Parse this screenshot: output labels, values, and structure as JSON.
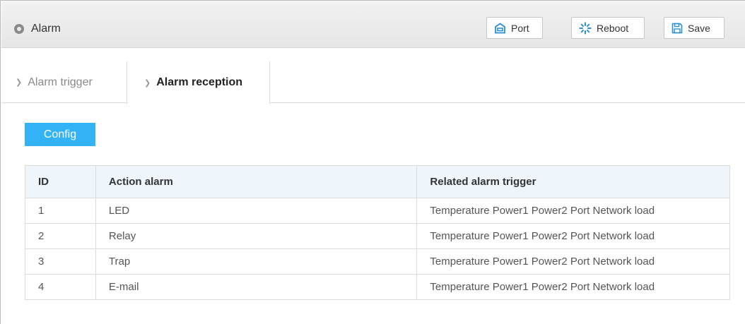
{
  "header": {
    "title": "Alarm",
    "buttons": {
      "port": "Port",
      "reboot": "Reboot",
      "save": "Save"
    }
  },
  "tabs": [
    {
      "label": "Alarm trigger",
      "active": false
    },
    {
      "label": "Alarm reception",
      "active": true
    }
  ],
  "config_label": "Config",
  "table": {
    "columns": [
      "ID",
      "Action alarm",
      "Related alarm trigger"
    ],
    "rows": [
      {
        "id": "1",
        "action": "LED",
        "related": "Temperature Power1 Power2 Port Network load"
      },
      {
        "id": "2",
        "action": "Relay",
        "related": "Temperature Power1 Power2 Port Network load"
      },
      {
        "id": "3",
        "action": "Trap",
        "related": "Temperature Power1 Power2 Port Network load"
      },
      {
        "id": "4",
        "action": "E-mail",
        "related": "Temperature Power1 Power2 Port Network load"
      }
    ]
  },
  "colors": {
    "accent": "#33b3f5",
    "header_bg": "#ececec",
    "table_header_bg": "#eef6fc",
    "icon_blue": "#2a8fd6"
  },
  "icons": {
    "title": "circle-icon",
    "port": "port-icon",
    "reboot": "reboot-spinner-icon",
    "save": "save-disk-icon",
    "tab_chevron": "chevron-right-icon"
  }
}
